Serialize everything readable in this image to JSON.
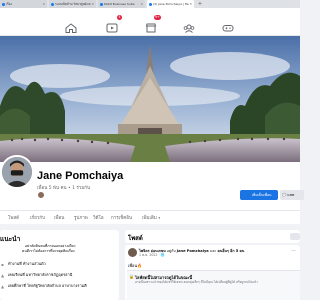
{
  "browser": {
    "tabs": [
      {
        "label": "เรื่อง",
        "favicon_color": "#1877f2",
        "active": false
      },
      {
        "label": "ระบบเปิดบ้าน วิทยาศูนย์และ ยุทธ 5",
        "favicon_color": "#1877f2",
        "active": false
      },
      {
        "label": "Kbbit Business Suite",
        "favicon_color": "#1877f2",
        "active": false
      },
      {
        "label": "(3) Jane Pomchaiya | Facebook",
        "favicon_color": "#1877f2",
        "active": true
      }
    ],
    "new_tab_label": "+"
  },
  "fbnav": {
    "badges": {
      "watch": "4",
      "marketplace": "9+"
    }
  },
  "profile": {
    "name": "Jane Pomchaiya",
    "friends": "เพื่อน 5 พัน คน • 1 ร่วมกัน",
    "buttons": {
      "primary": "เพิ่มเป็นเพื่อน",
      "secondary": "แชท"
    },
    "tabs": [
      "โพสต์",
      "เกี่ยวกับ",
      "เพื่อน",
      "รูปภาพ",
      "วิดีโอ",
      "การเช็คอิน",
      "เพิ่มเติม"
    ]
  },
  "intro": {
    "title": "แนะนำ",
    "bio_line1": "อย่าตัดสินคนที่ภายนอกอย่างเดียว",
    "bio_line2": "คนดีเราไม่ต้องการที่จะหยุดคิดเรื่อง",
    "rows": [
      {
        "icon": "briefcase-icon",
        "text": "ทำงานที่ ทำงานส่วนตัว"
      },
      {
        "icon": "education-icon",
        "text": "เคยเรียนที่ มหาวิทยาลัยราชภัฏอุดรธานี"
      },
      {
        "icon": "education-icon",
        "text": "เคยศึกษาที่ ไทยรัฐวิทยาลัยตำบล อาษาบางรามคี"
      }
    ]
  },
  "posts_header": {
    "title": "โพสต์"
  },
  "post": {
    "author_line": "ไพจิตร อ่อนเกษม",
    "with_text": "อยู่กับ",
    "tag_name": "Jane Pomchaiya",
    "and_text": "และ",
    "others": "คนอื่นๆ อีก 5 คน",
    "meta": "1 พ.ค. 2022 · 🌐",
    "body": "เพื่อน🔥",
    "card_title": "ไลฟ์สดนี้ไม่สามารถดูได้ในขณะนี้",
    "card_sub": "อาจเป็นเพราะเจ้าของได้แชร์ให้เฉพาะคนกลุ่มเล็กๆ ที่ไม่มีคุณ ได้เปลี่ยนผู้ที่ดูได้ หรือถูกลบไปแล้ว"
  },
  "colors": {
    "facebook_blue": "#1b74e4",
    "badge_red": "#e41e3f"
  }
}
